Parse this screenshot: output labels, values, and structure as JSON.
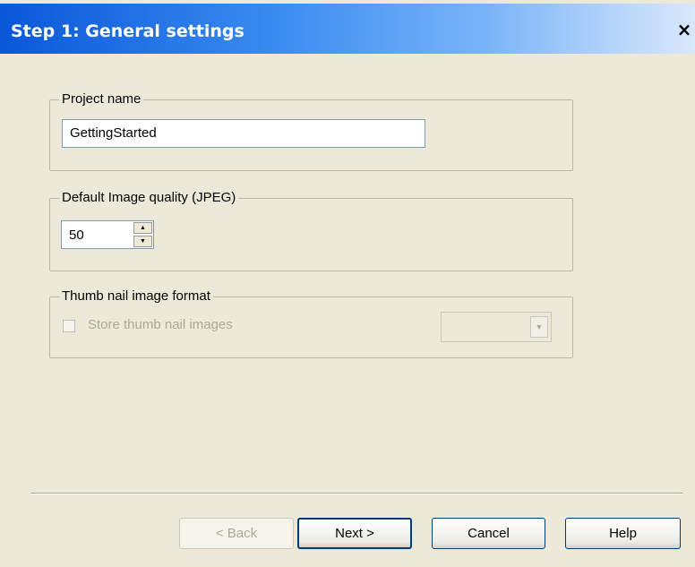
{
  "dialog": {
    "title": "Step 1: General settings",
    "close_glyph": "×"
  },
  "project_name": {
    "legend": "Project name",
    "value": "GettingStarted"
  },
  "image_quality": {
    "legend": "Default Image quality (JPEG)",
    "value": "50",
    "up_glyph": "▲",
    "down_glyph": "▼"
  },
  "thumbnail": {
    "legend": "Thumb nail image format",
    "checkbox_label": "Store thumb nail images",
    "checked": false,
    "enabled": false,
    "format_value": "",
    "dropdown_glyph": "▼"
  },
  "buttons": {
    "back": "< Back",
    "next": "Next >",
    "cancel": "Cancel",
    "help": "Help"
  },
  "colors": {
    "titlebar_start": "#0A57D9",
    "dialog_bg": "#ECE9D8",
    "disabled_text": "#ACA899"
  }
}
